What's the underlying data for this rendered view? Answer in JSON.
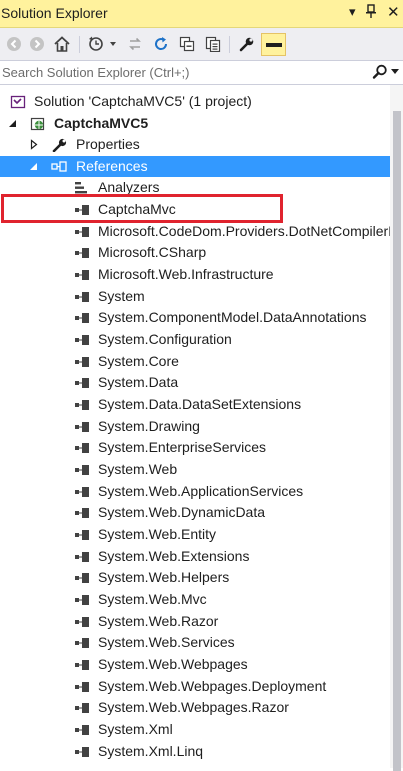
{
  "window": {
    "title": "Solution Explorer"
  },
  "search": {
    "placeholder": "Search Solution Explorer (Ctrl+;)"
  },
  "colors": {
    "titlebar": "#fff29d",
    "selection": "#3399ff",
    "highlight_box": "#e0232e"
  },
  "toolbar": {
    "icons": [
      "back-icon",
      "forward-icon",
      "home-icon",
      "pending-changes-icon",
      "sync-icon",
      "refresh-icon",
      "collapse-all-icon",
      "show-all-files-icon",
      "properties-icon",
      "preview-icon"
    ]
  },
  "tree": {
    "solution": "Solution 'CaptchaMVC5' (1 project)",
    "project": "CaptchaMVC5",
    "properties": "Properties",
    "references": "References",
    "analyzers": "Analyzers",
    "items": [
      "CaptchaMvc",
      "Microsoft.CodeDom.Providers.DotNetCompilerPlatform",
      "Microsoft.CSharp",
      "Microsoft.Web.Infrastructure",
      "System",
      "System.ComponentModel.DataAnnotations",
      "System.Configuration",
      "System.Core",
      "System.Data",
      "System.Data.DataSetExtensions",
      "System.Drawing",
      "System.EnterpriseServices",
      "System.Web",
      "System.Web.ApplicationServices",
      "System.Web.DynamicData",
      "System.Web.Entity",
      "System.Web.Extensions",
      "System.Web.Helpers",
      "System.Web.Mvc",
      "System.Web.Razor",
      "System.Web.Services",
      "System.Web.Webpages",
      "System.Web.Webpages.Deployment",
      "System.Web.Webpages.Razor",
      "System.Xml",
      "System.Xml.Linq"
    ]
  }
}
